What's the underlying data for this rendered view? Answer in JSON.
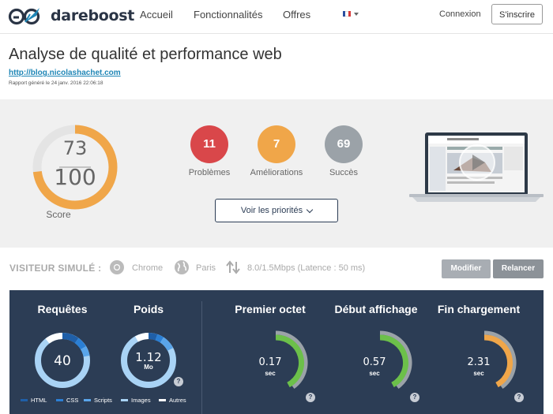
{
  "nav": {
    "brand": "dareboost",
    "links": [
      "Accueil",
      "Fonctionnalités",
      "Offres"
    ],
    "login": "Connexion",
    "signup": "S'inscrire"
  },
  "header": {
    "title": "Analyse de qualité et performance web",
    "url": "http://blog.nicolashachet.com",
    "report_date": "Rapport généré le 24 janv. 2016 22:06:18"
  },
  "summary": {
    "score": "73",
    "score_max": "100",
    "score_label": "Score",
    "score_fraction": 0.73,
    "problems": {
      "count": "11",
      "label": "Problèmes",
      "color": "#d9474a"
    },
    "improvements": {
      "count": "7",
      "label": "Améliorations",
      "color": "#f0a649"
    },
    "successes": {
      "count": "69",
      "label": "Succès",
      "color": "#9ba2a8"
    },
    "priorities_button": "Voir les priorités"
  },
  "simulated_visitor": {
    "title": "VISITEUR SIMULÉ :",
    "browser": "Chrome",
    "location": "Paris",
    "connection": "8.0/1.5Mbps (Latence : 50 ms)",
    "modify_button": "Modifier",
    "rerun_button": "Relancer"
  },
  "metrics": {
    "requests": {
      "label": "Requêtes",
      "value": "40"
    },
    "weight": {
      "label": "Poids",
      "value": "1.12",
      "unit": "Mo"
    },
    "first_byte": {
      "label": "Premier octet",
      "value": "0.17",
      "unit": "sec",
      "color": "#6cc04a"
    },
    "start_render": {
      "label": "Début affichage",
      "value": "0.57",
      "unit": "sec",
      "color": "#6cc04a"
    },
    "load_end": {
      "label": "Fin chargement",
      "value": "2.31",
      "unit": "sec",
      "color": "#f0a649"
    },
    "help": "?",
    "legend": [
      {
        "label": "HTML",
        "color": "#1f5fa8"
      },
      {
        "label": "CSS",
        "color": "#2b7fd4"
      },
      {
        "label": "Scripts",
        "color": "#5aa5ea"
      },
      {
        "label": "Images",
        "color": "#a9d3f5"
      },
      {
        "label": "Autres",
        "color": "#ffffff"
      }
    ]
  },
  "colors": {
    "accent": "#f0a649",
    "dark": "#2c3d55",
    "link": "#1f86b6"
  }
}
